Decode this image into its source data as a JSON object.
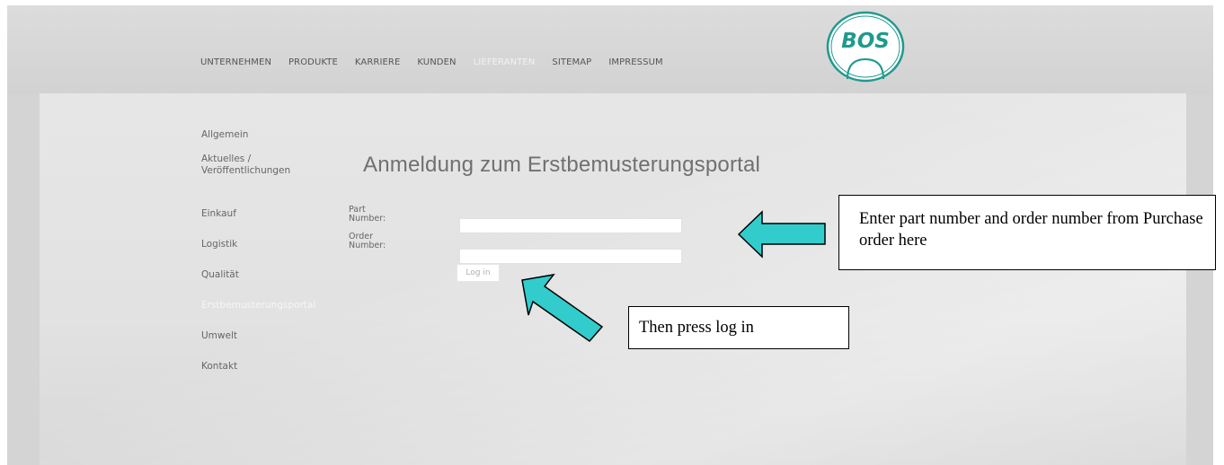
{
  "nav": {
    "items": [
      "UNTERNEHMEN",
      "PRODUKTE",
      "KARRIERE",
      "KUNDEN",
      "LIEFERANTEN",
      "SITEMAP",
      "IMPRESSUM"
    ],
    "active": "LIEFERANTEN"
  },
  "logo": {
    "text": "BOS",
    "color": "#1f9a8d"
  },
  "sidebar": {
    "items": [
      {
        "label": "Allgemein"
      },
      {
        "label": "Aktuelles /\nVeröffentlichungen"
      },
      {
        "label": "Einkauf"
      },
      {
        "label": "Logistik"
      },
      {
        "label": "Qualität"
      },
      {
        "label": "Erstbemusterungsportal"
      },
      {
        "label": "Umwelt"
      },
      {
        "label": "Kontakt"
      }
    ],
    "active": "Erstbemusterungsportal"
  },
  "form": {
    "title": "Anmeldung zum Erstbemusterungsportal",
    "part_label": "Part\nNumber:",
    "part_value": "",
    "order_label": "Order\nNumber:",
    "order_value": "",
    "login_label": "Log in"
  },
  "annotations": {
    "enter_text": "Enter part number and order number from  Purchase order here",
    "login_text": "Then press log in",
    "arrow_color": "#33cccc"
  }
}
